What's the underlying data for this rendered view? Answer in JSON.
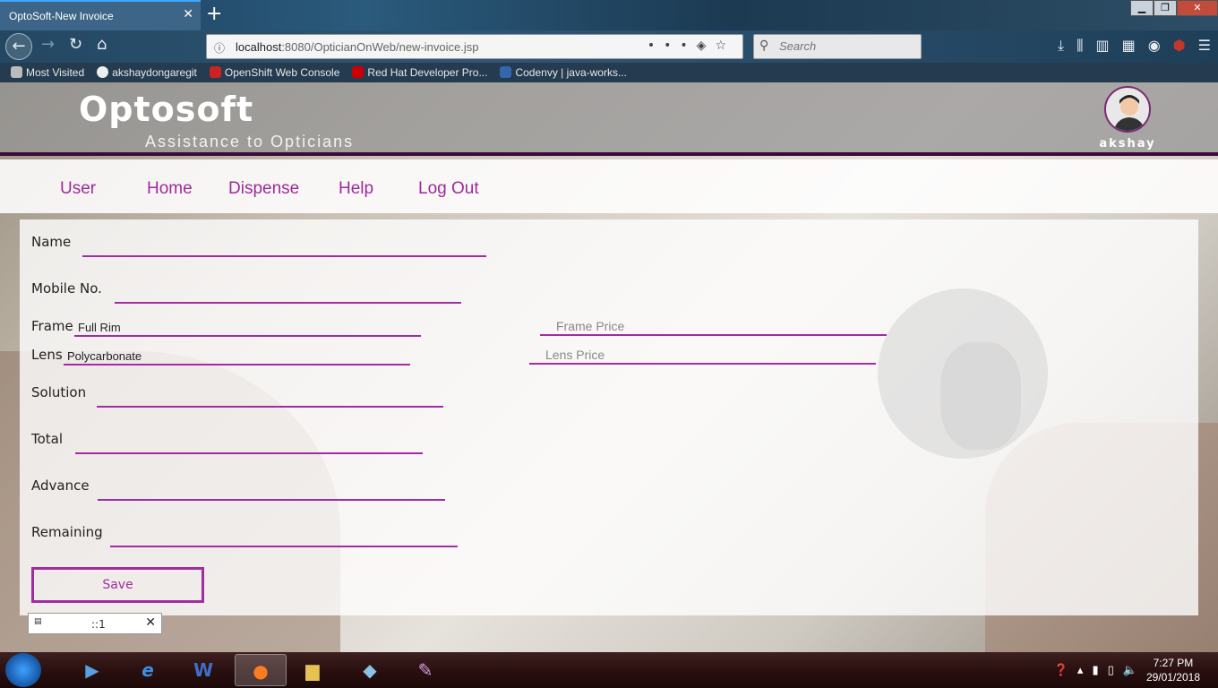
{
  "browser": {
    "tab_title": "OptoSoft-New Invoice",
    "url_host": "localhost",
    "url_rest": ":8080/OpticianOnWeb/new-invoice.jsp",
    "search_placeholder": "Search",
    "bookmarks": [
      {
        "label": "Most Visited",
        "icon": "gear-icon",
        "color": "#bbbbbb"
      },
      {
        "label": "akshaydongaregit",
        "icon": "github-icon",
        "color": "#222222"
      },
      {
        "label": "OpenShift Web Console",
        "icon": "openshift-icon",
        "color": "#cc2222"
      },
      {
        "label": "Red Hat Developer Pro...",
        "icon": "redhat-icon",
        "color": "#cc0000"
      },
      {
        "label": "Codenvy | java-works...",
        "icon": "cloud-icon",
        "color": "#3366aa"
      }
    ]
  },
  "app": {
    "brand": "Optosoft",
    "tagline": "Assistance to Opticians",
    "username": "akshay",
    "accent_color": "#a32ca0",
    "menu": [
      "User",
      "Home",
      "Dispense",
      "Help",
      "Log Out"
    ]
  },
  "form": {
    "name_label": "Name",
    "name_value": "",
    "mobile_label": "Mobile No.",
    "mobile_value": "",
    "frame_label": "Frame",
    "frame_value": "Full Rim",
    "frame_price_placeholder": "Frame Price",
    "lens_label": "Lens",
    "lens_value": "Polycarbonate",
    "lens_price_placeholder": "Lens Price",
    "solution_label": "Solution",
    "total_label": "Total",
    "advance_label": "Advance",
    "remaining_label": "Remaining",
    "save_label": "Save"
  },
  "popup": {
    "text": "::1"
  },
  "taskbar": {
    "time": "7:27 PM",
    "date": "29/01/2018"
  }
}
